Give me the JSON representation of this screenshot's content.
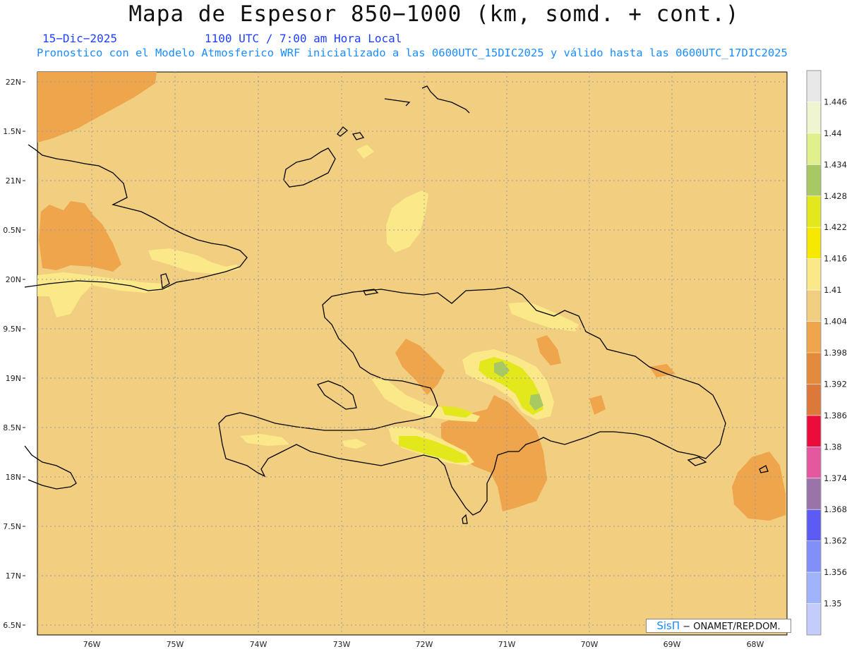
{
  "header": {
    "title": "Mapa de Espesor 850−1000 (km, somd. + cont.)",
    "date": "15−Dic−2025",
    "time": "1100 UTC / 7:00 am Hora Local",
    "subtitle": "Pronostico con el Modelo Atmosferico WRF inicializado a las 0600UTC_15DIC2025 y válido hasta las  0600UTC_17DIC2025"
  },
  "credit": {
    "brand": "SisΠ",
    "text": "− ONAMET/REP.DOM."
  },
  "colors": {
    "land_ocean_base": "#f2cf80",
    "coastline": "#000000",
    "grid": "#9a9aa6"
  },
  "axes": {
    "lon_labels": [
      "76W",
      "75W",
      "74W",
      "73W",
      "72W",
      "71W",
      "70W",
      "69W",
      "68W"
    ],
    "lat_labels": [
      "22N",
      "1.5N",
      "21N",
      "0.5N",
      "20N",
      "9.5N",
      "19N",
      "8.5N",
      "18N",
      "7.5N",
      "17N",
      "6.5N"
    ]
  },
  "colorbar": {
    "labels": [
      "1.446",
      "1.44",
      "1.434",
      "1.428",
      "1.422",
      "1.416",
      "1.41",
      "1.404",
      "1.398",
      "1.392",
      "1.386",
      "1.38",
      "1.374",
      "1.368",
      "1.362",
      "1.356",
      "1.35"
    ],
    "colors": [
      "#e8e8e8",
      "#f0f4d0",
      "#e0f08c",
      "#a8c864",
      "#e2e81c",
      "#f6e800",
      "#fbe888",
      "#f2cf80",
      "#eea54c",
      "#e48a3c",
      "#dc783a",
      "#ec0c3c",
      "#e458a0",
      "#9a74a8",
      "#5c5cf4",
      "#8090f8",
      "#a0b4fc",
      "#c4ccfc"
    ]
  }
}
